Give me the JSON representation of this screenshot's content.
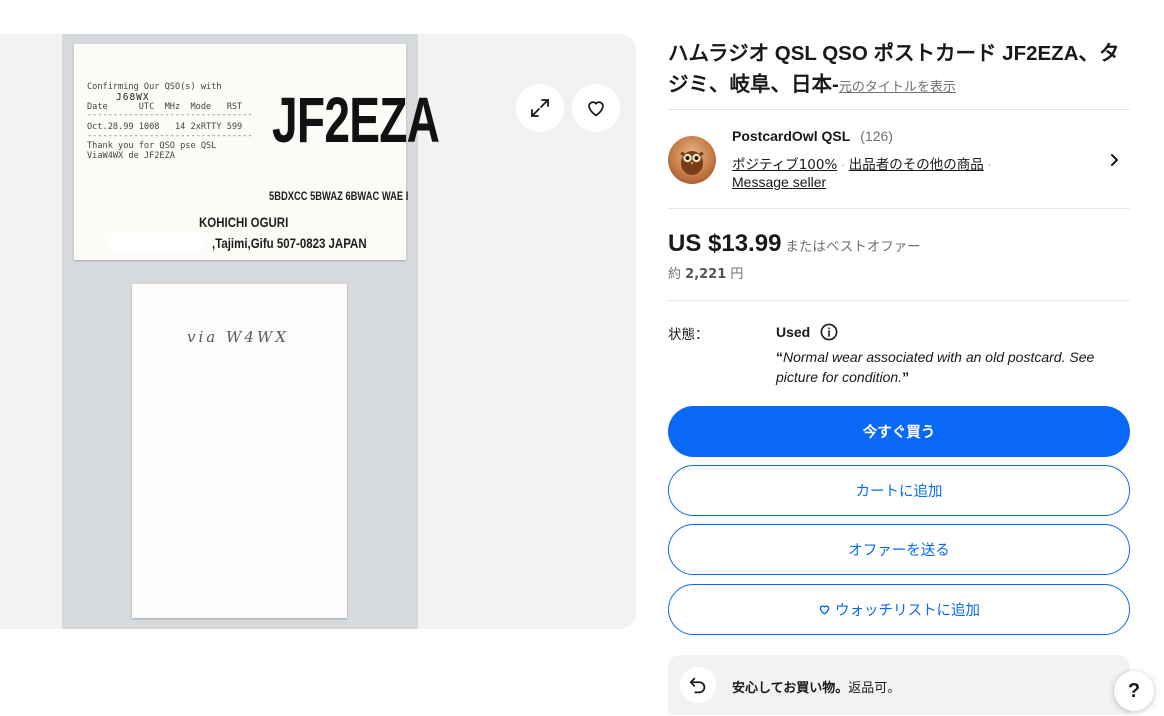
{
  "gallery": {
    "card_front": {
      "confirming": "Confirming Our QSO(s) with",
      "worked_call": "J68WX",
      "columns": "Date      UTC  MHz  Mode   RST",
      "dashes": "--------------------------------",
      "log_line": "Oct.28.99 1008   14 2xRTTY 599",
      "thanks": "Thank you for QSO pse QSL",
      "via": "ViaW4WX de JF2EZA",
      "callsign": "JF2EZA",
      "awards": "5BDXCC  5BWAZ  6BWAC  WAE I",
      "operator": "KOHICHI  OGURI",
      "address": ",Tajimi,Gifu 507-0823 JAPAN"
    },
    "card_back": {
      "handwriting": "via W4WX"
    }
  },
  "listing": {
    "title": "ハムラジオ QSL QSO ポストカード JF2EZA、タジミ、岐阜、日本-",
    "original_title_link": "元のタイトルを表示"
  },
  "seller": {
    "name": "PostcardOwl QSL",
    "feedback_count": "(126)",
    "positive": "ポジティブ100%",
    "other_items": "出品者のその他の商品",
    "message": "Message seller"
  },
  "price": {
    "amount": "US $13.99",
    "best_offer": "またはベストオファー",
    "approx_prefix": "約",
    "approx_value": "2,221",
    "approx_unit": "円"
  },
  "condition": {
    "label": "状態：",
    "value": "Used",
    "description": "Normal wear associated with an old postcard. See picture for condition."
  },
  "actions": {
    "buy_now": "今すぐ買う",
    "add_to_cart": "カートに追加",
    "make_offer": "オファーを送る",
    "add_to_watchlist": "ウォッチリストに追加"
  },
  "assurance": {
    "bold": "安心してお買い物。",
    "text": "返品可。"
  },
  "help": "?",
  "colors": {
    "primary_blue": "#0968f6",
    "text": "#191919",
    "muted": "#707070"
  }
}
